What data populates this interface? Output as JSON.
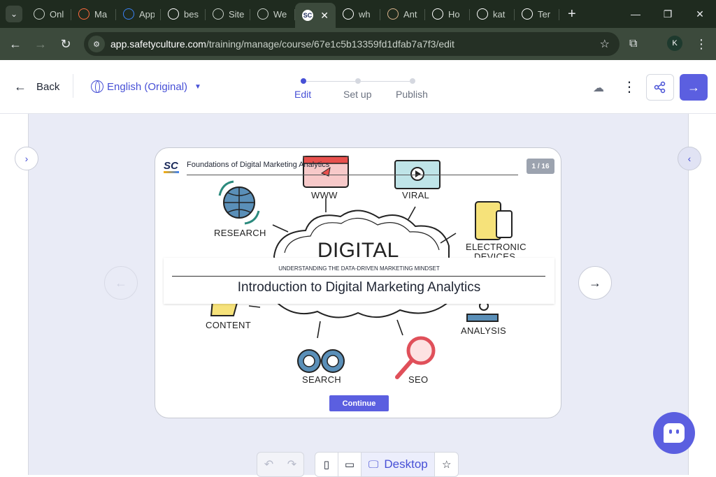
{
  "browser": {
    "tabs": [
      {
        "label": "Onl",
        "icon": "gear-favicon-icon",
        "color": "#c8d0c8"
      },
      {
        "label": "Ma",
        "icon": "make-favicon-icon",
        "color": "#ff6a3d"
      },
      {
        "label": "App",
        "icon": "butterfly-favicon-icon",
        "color": "#3b82f6"
      },
      {
        "label": "bes",
        "icon": "google-favicon-icon",
        "color": "#ffffff"
      },
      {
        "label": "Site",
        "icon": "globe-favicon-icon",
        "color": "#c8d0c8"
      },
      {
        "label": "We",
        "icon": "globe-favicon-icon",
        "color": "#c8d0c8"
      },
      {
        "label": "SC",
        "icon": "safetyculture-favicon-icon",
        "color": "#ffffff",
        "active": true
      },
      {
        "label": "wh",
        "icon": "google-favicon-icon",
        "color": "#ffffff"
      },
      {
        "label": "Ant",
        "icon": "anthropic-favicon-icon",
        "color": "#d9b38c"
      },
      {
        "label": "Ho",
        "icon": "google-favicon-icon",
        "color": "#ffffff"
      },
      {
        "label": "kat",
        "icon": "github-favicon-icon",
        "color": "#ffffff"
      },
      {
        "label": "Ter",
        "icon": "safetyculture-favicon-icon",
        "color": "#ffffff"
      }
    ],
    "url_host": "app.safetyculture.com",
    "url_path": "/training/manage/course/67e1c5b13359fd1dfab7a7f3/edit",
    "profile_initial": "K"
  },
  "appbar": {
    "back_label": "Back",
    "language": "English (Original)",
    "steps": [
      {
        "label": "Edit",
        "active": true
      },
      {
        "label": "Set up",
        "active": false
      },
      {
        "label": "Publish",
        "active": false
      }
    ]
  },
  "slide": {
    "logo_text": "SC",
    "course_title": "Foundations of Digital Marketing Analytics",
    "page_indicator": "1 / 16",
    "illustration_words": [
      "WWW",
      "VIRAL",
      "RESEARCH",
      "ELECTRONIC",
      "DEVICES",
      "DIGITAL",
      "CONTENT",
      "ANALYSIS",
      "SEARCH",
      "SEO"
    ],
    "kicker": "UNDERSTANDING THE DATA-DRIVEN MARKETING MINDSET",
    "headline": "Introduction to Digital Marketing Analytics",
    "continue_label": "Continue"
  },
  "bottombar": {
    "device_active_label": "Desktop"
  },
  "colors": {
    "accent": "#5b5fe0",
    "accent_text": "#4750d6",
    "canvas": "#e9ebf6"
  }
}
